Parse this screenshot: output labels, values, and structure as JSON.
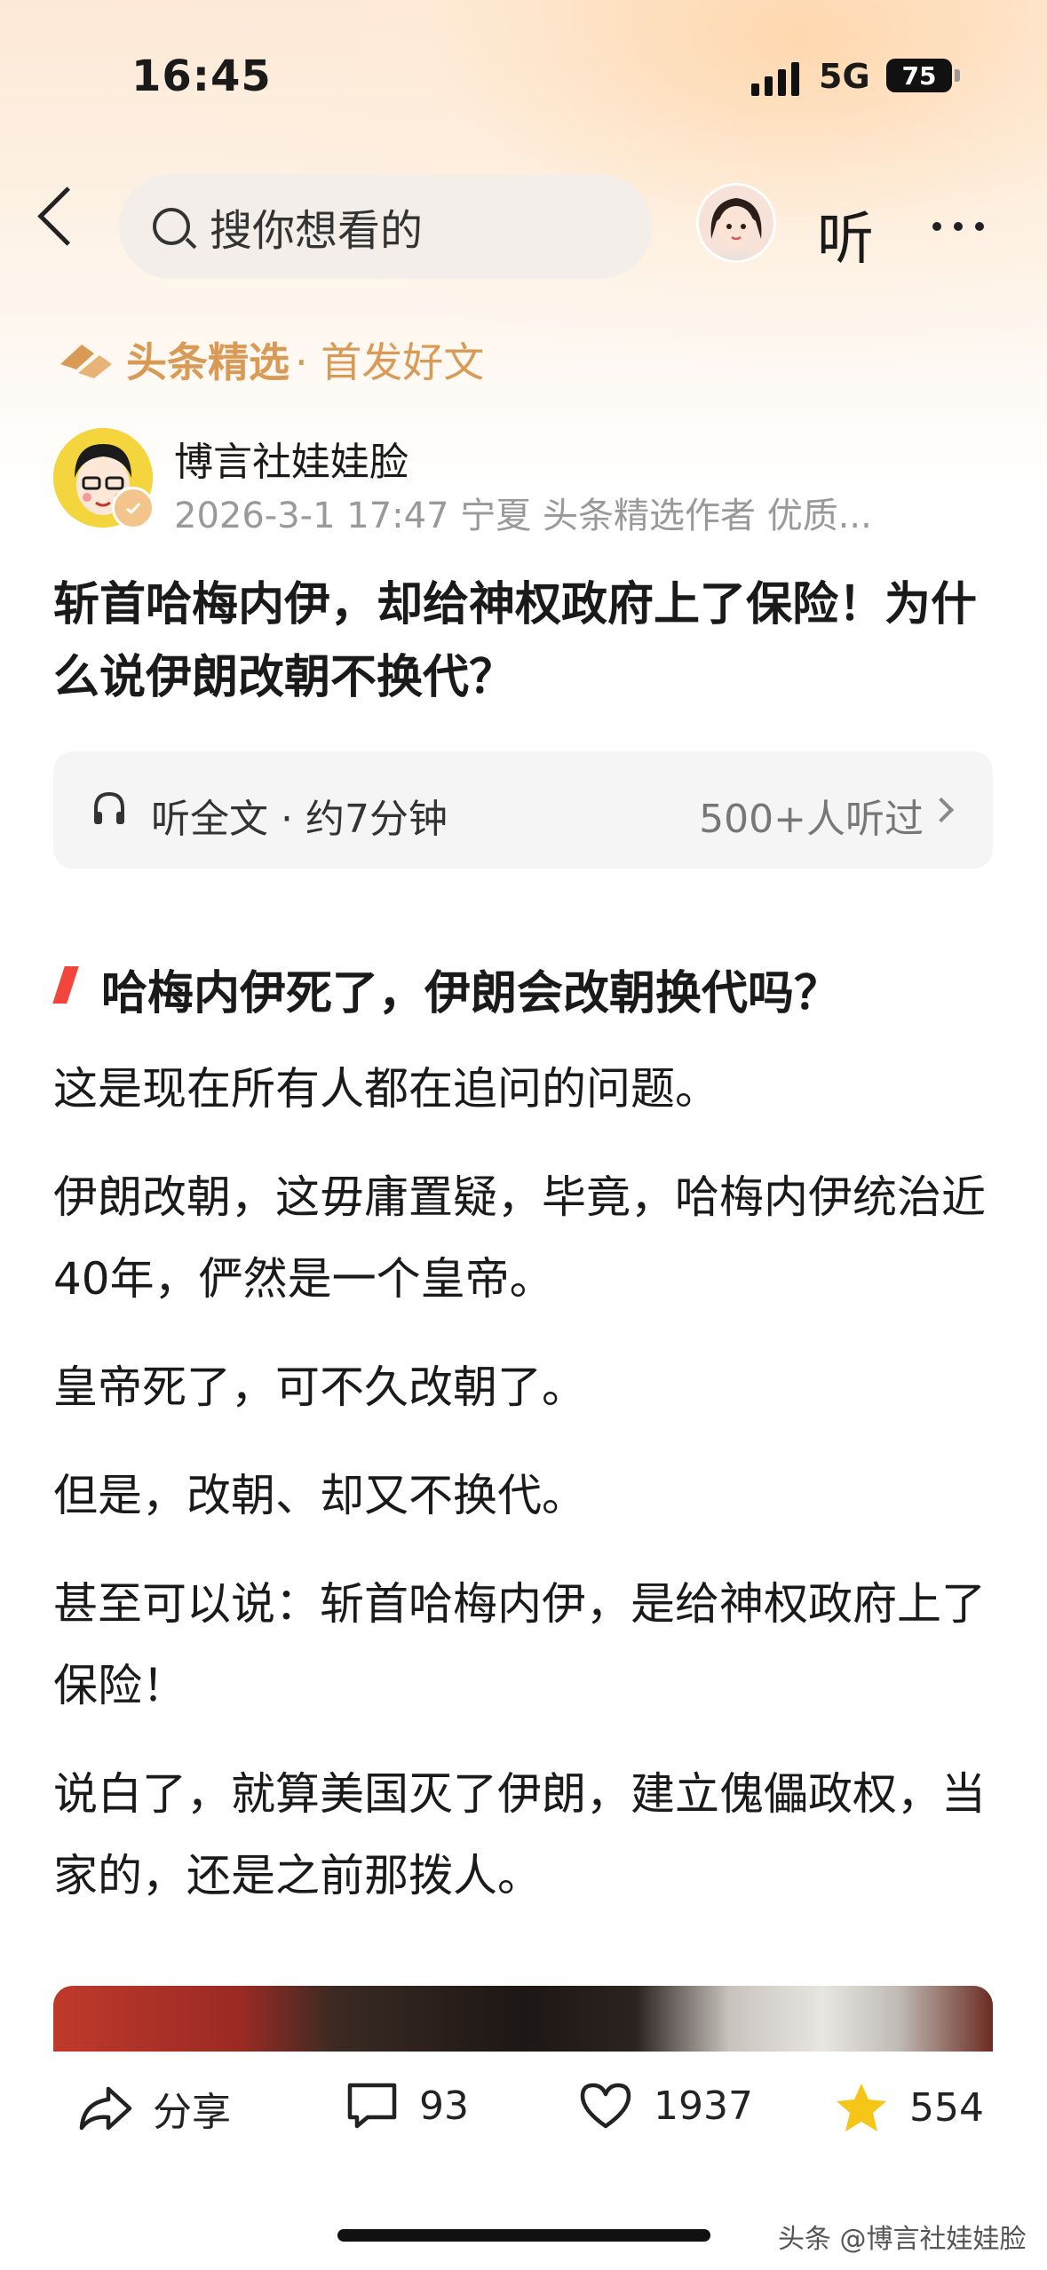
{
  "status_bar": {
    "time": "16:45",
    "network": "5G",
    "battery": "75"
  },
  "nav": {
    "search_placeholder": "搜你想看的",
    "listen_label": "听"
  },
  "brand": {
    "name": "头条精选",
    "subtitle": "· 首发好文"
  },
  "author": {
    "name": "博言社娃娃脸",
    "meta": "2026-3-1 17:47 宁夏 头条精选作者 优质..."
  },
  "article": {
    "title": "斩首哈梅内伊，却给神权政府上了保险！为什么说伊朗改朝不换代？",
    "listen_full": "听全文 · 约7分钟",
    "listen_count": "500+人听过",
    "section_heading": "哈梅内伊死了，伊朗会改朝换代吗？",
    "paragraphs": [
      "这是现在所有人都在追问的问题。",
      "伊朗改朝，这毋庸置疑，毕竟，哈梅内伊统治近40年，俨然是一个皇帝。",
      "皇帝死了，可不久改朝了。",
      "但是，改朝、却又不换代。",
      "甚至可以说：斩首哈梅内伊，是给神权政府上了保险！",
      "说白了，就算美国灭了伊朗，建立傀儡政权，当家的，还是之前那拨人。"
    ]
  },
  "actions": {
    "share": "分享",
    "comments": "93",
    "likes": "1937",
    "favorites": "554"
  },
  "watermark": "头条 @博言社娃娃脸",
  "colors": {
    "brand_gold": "#d89a55",
    "accent_red": "#f2453c",
    "star_yellow": "#f5c518"
  }
}
